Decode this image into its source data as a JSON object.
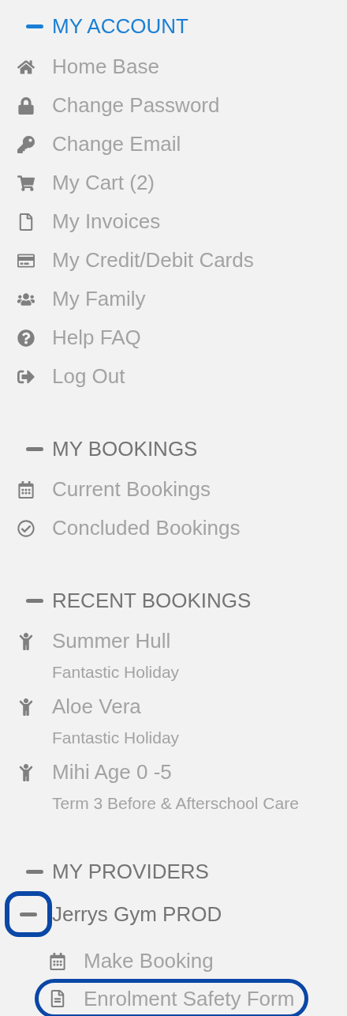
{
  "sections": [
    {
      "title": "MY ACCOUNT",
      "active": true,
      "expanded": true,
      "items": [
        {
          "label": "Home Base"
        },
        {
          "label": "Change Password"
        },
        {
          "label": "Change Email"
        },
        {
          "label": "My Cart (2)"
        },
        {
          "label": "My Invoices"
        },
        {
          "label": "My Credit/Debit Cards"
        },
        {
          "label": "My Family"
        },
        {
          "label": "Help FAQ"
        },
        {
          "label": "Log Out"
        }
      ]
    },
    {
      "title": "MY BOOKINGS",
      "active": false,
      "expanded": true,
      "items": [
        {
          "label": "Current Bookings"
        },
        {
          "label": "Concluded Bookings"
        }
      ]
    },
    {
      "title": "RECENT BOOKINGS",
      "active": false,
      "expanded": true,
      "items": [
        {
          "label": "Summer Hull",
          "details": [
            "Fantastic Holiday"
          ]
        },
        {
          "label": "Aloe Vera",
          "details": [
            "Fantastic Holiday"
          ]
        },
        {
          "label": "Mihi Age 0 -5",
          "details": [
            "Term 3 Before & Afterschool Care"
          ]
        }
      ]
    },
    {
      "title": "MY PROVIDERS",
      "active": false,
      "expanded": true,
      "providers": [
        {
          "name": "Jerrys Gym PROD",
          "expanded": true,
          "highlighted": true,
          "items": [
            {
              "label": "Make Booking",
              "highlighted": false
            },
            {
              "label": "Enrolment Safety Form",
              "highlighted": true
            }
          ]
        }
      ]
    }
  ]
}
